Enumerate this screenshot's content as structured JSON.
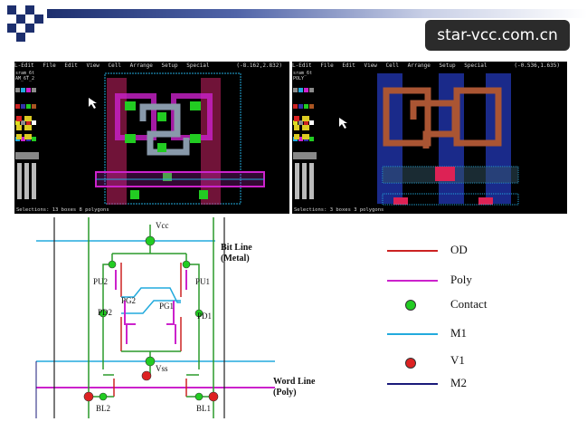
{
  "watermark": "star-vcc.com.cn",
  "editor_left": {
    "menu": [
      "L-Edit",
      "File",
      "Edit",
      "View",
      "Cell",
      "Arrange",
      "Setup",
      "Special"
    ],
    "coords": "(-8.162,2.832)",
    "lib_line1": "sram_6t",
    "lib_line2": "AM_6T_2",
    "status": "Selections: 13 boxes 8 polygons"
  },
  "editor_right": {
    "menu": [
      "L-Edit",
      "File",
      "Edit",
      "View",
      "Cell",
      "Arrange",
      "Setup",
      "Special"
    ],
    "coords": "(-0.536,1.635)",
    "lib_line1": "sram_6t",
    "lib_line2": "POLY",
    "status": "Selections: 3 boxes 3 polygons"
  },
  "palette_labels": {
    "mouse": "Mouse",
    "buttons": "Buttons"
  },
  "schematic": {
    "vcc": "Vcc",
    "vss": "Vss",
    "bitline": "Bit Line",
    "bitline_sub": "(Metal)",
    "wordline": "Word Line",
    "wordline_sub": "(Poly)",
    "pu2": "PU2",
    "pu1": "PU1",
    "pg2": "PG2",
    "pg1": "PG1",
    "pd2": "PD2",
    "pd1": "PD1",
    "bl2": "BL2",
    "bl1": "BL1"
  },
  "legend": [
    {
      "label": "OD",
      "kind": "line",
      "color": "#cc2222"
    },
    {
      "label": "Poly",
      "kind": "line",
      "color": "#cc22cc"
    },
    {
      "label": "Contact",
      "kind": "dot",
      "color": "#22cc22"
    },
    {
      "label": "M1",
      "kind": "line",
      "color": "#22aadd"
    },
    {
      "label": "V1",
      "kind": "dot",
      "color": "#dd2222"
    },
    {
      "label": "M2",
      "kind": "line",
      "color": "#1a1a7a"
    }
  ],
  "colors": {
    "od": "#cc2222",
    "poly": "#cc22cc",
    "contact": "#22cc22",
    "m1": "#22aadd",
    "v1": "#dd2222",
    "m2": "#1a1a7a",
    "bitline": "#2a9a2a"
  }
}
